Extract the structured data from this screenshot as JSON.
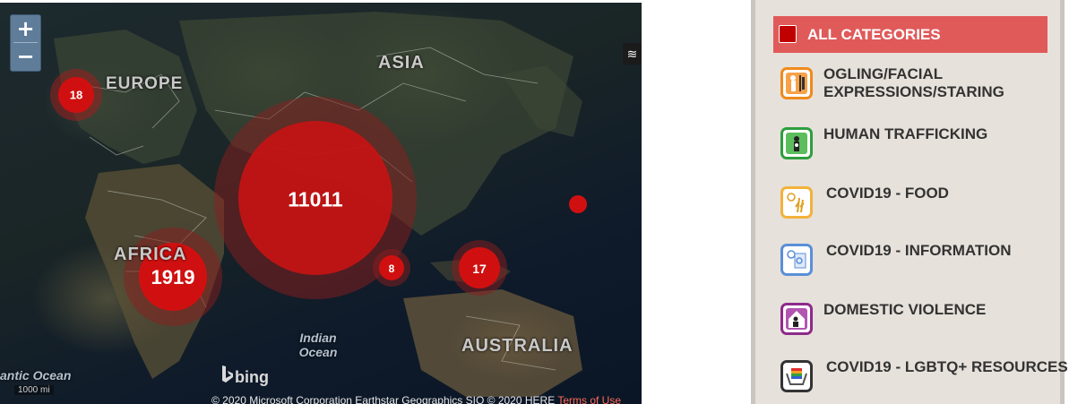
{
  "map": {
    "zoom_in_label": "+",
    "zoom_out_label": "−",
    "layers_icon": "≋",
    "regions": {
      "europe": "EUROPE",
      "asia": "ASIA",
      "africa": "AFRICA",
      "australia": "AUSTRALIA"
    },
    "oceans": {
      "indian_line1": "Indian",
      "indian_line2": "Ocean",
      "atlantic": "antic Ocean"
    },
    "clusters": [
      {
        "count": "18"
      },
      {
        "count": "11011"
      },
      {
        "count": "1919"
      },
      {
        "count": "8"
      },
      {
        "count": "17"
      },
      {
        "count": ""
      }
    ],
    "bing_label": "bing",
    "scale_label": "1000 mi",
    "copyright": "© 2020 Microsoft Corporation Earthstar Geographics SIO © 2020 HERE",
    "terms_label": "Terms of Use",
    "colors": {
      "cluster": "#d01010",
      "halo": "#b82020"
    }
  },
  "sidebar": {
    "all_categories": {
      "label": "ALL CATEGORIES",
      "color": "#e05a5a"
    },
    "categories": [
      {
        "label": "OGLING/FACIAL EXPRESSIONS/STARING",
        "icon": "ogling-icon",
        "border": "#f08a1c"
      },
      {
        "label": "HUMAN TRAFFICKING",
        "icon": "human-trafficking-icon",
        "border": "#2e9e3e"
      },
      {
        "label": "COVID19 - FOOD",
        "icon": "covid-food-icon",
        "border": "#f2b23a"
      },
      {
        "label": "COVID19 - INFORMATION",
        "icon": "covid-information-icon",
        "border": "#5a8fd8"
      },
      {
        "label": "DOMESTIC VIOLENCE",
        "icon": "domestic-violence-icon",
        "border": "#8e2a8c"
      },
      {
        "label": "COVID19 - LGBTQ+ RESOURCES",
        "icon": "lgbtq-resources-icon",
        "border": "#333333"
      }
    ]
  }
}
